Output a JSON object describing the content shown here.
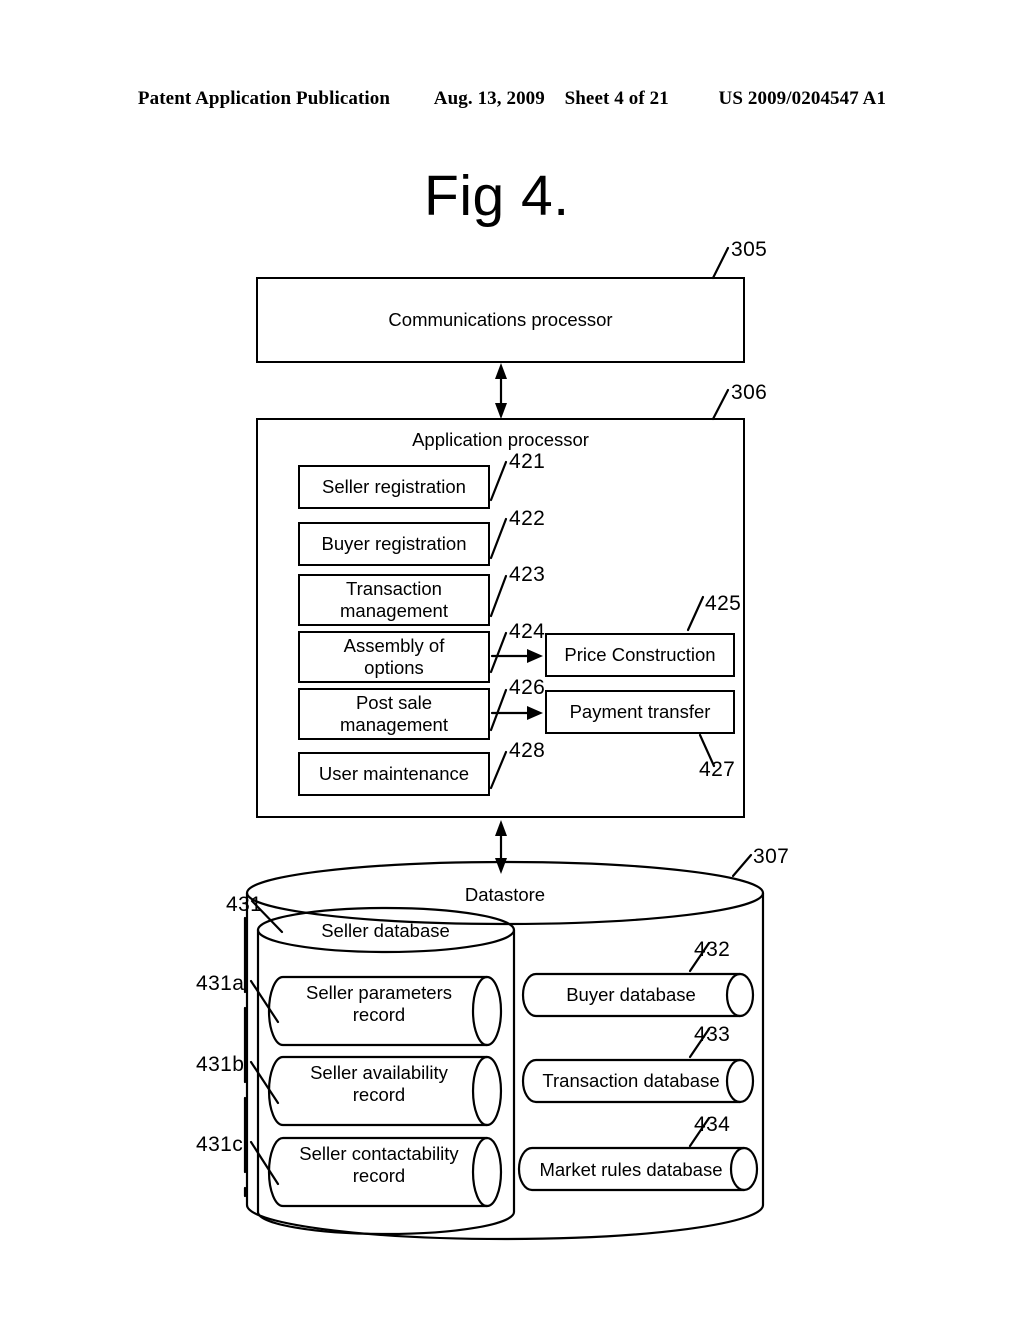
{
  "header": {
    "publication": "Patent Application Publication",
    "date": "Aug. 13, 2009",
    "sheet": "Sheet 4 of 21",
    "docnumber": "US 2009/0204547 A1"
  },
  "figure": {
    "title": "Fig 4."
  },
  "blocks": {
    "communications_processor": {
      "label": "Communications processor",
      "ref": "305"
    },
    "application_processor": {
      "label": "Application processor",
      "ref": "306"
    },
    "datastore": {
      "label": "Datastore",
      "ref": "307"
    }
  },
  "application_modules": [
    {
      "label": "Seller registration",
      "ref": "421"
    },
    {
      "label": "Buyer registration",
      "ref": "422"
    },
    {
      "label": "Transaction\nmanagement",
      "ref": "423"
    },
    {
      "label": "Assembly of\noptions",
      "ref": "424"
    },
    {
      "label": "Post sale\nmanagement",
      "ref": "426"
    },
    {
      "label": "User maintenance",
      "ref": "428"
    }
  ],
  "application_outputs": [
    {
      "label": "Price Construction",
      "ref": "425"
    },
    {
      "label": "Payment transfer",
      "ref": "427"
    }
  ],
  "datastore_contents": {
    "seller_database": {
      "label": "Seller database",
      "ref": "431"
    },
    "seller_records": [
      {
        "label": "Seller parameters\nrecord",
        "ref": "431a"
      },
      {
        "label": "Seller availability\nrecord",
        "ref": "431b"
      },
      {
        "label": "Seller contactability\nrecord",
        "ref": "431c"
      }
    ],
    "other_databases": [
      {
        "label": "Buyer database",
        "ref": "432"
      },
      {
        "label": "Transaction database",
        "ref": "433"
      },
      {
        "label": "Market rules database",
        "ref": "434"
      }
    ]
  },
  "colors": {
    "ink": "#000000",
    "paper": "#ffffff"
  }
}
